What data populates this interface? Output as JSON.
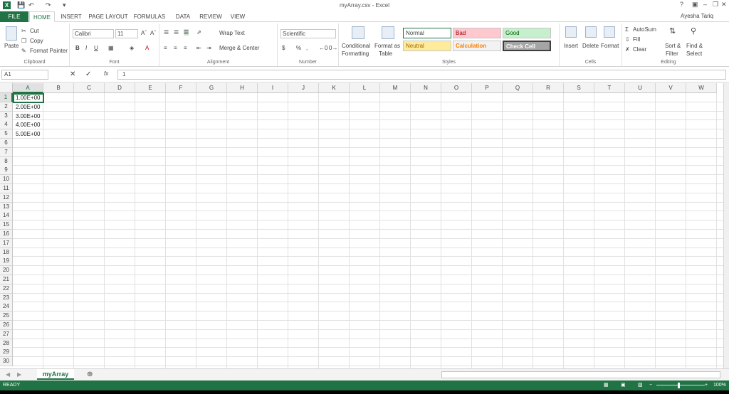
{
  "window": {
    "title": "myArray.csv - Excel",
    "help": "?",
    "user": "Ayesha Tariq"
  },
  "tabs": [
    "FILE",
    "HOME",
    "INSERT",
    "PAGE LAYOUT",
    "FORMULAS",
    "DATA",
    "REVIEW",
    "VIEW"
  ],
  "ribbon": {
    "clipboard": {
      "paste": "Paste",
      "cut": "Cut",
      "copy": "Copy",
      "format_painter": "Format Painter",
      "label": "Clipboard"
    },
    "font": {
      "name": "Calibri",
      "size": "11",
      "label": "Font",
      "bold": "B",
      "italic": "I",
      "underline": "U"
    },
    "alignment": {
      "wrap": "Wrap Text",
      "merge": "Merge & Center",
      "label": "Alignment"
    },
    "number": {
      "format": "Scientific",
      "currency": "$",
      "percent": "%",
      "comma": ",",
      "label": "Number"
    },
    "styles": {
      "conditional": "Conditional",
      "formatting": "Formatting",
      "format_as": "Format as",
      "table": "Table",
      "normal": "Normal",
      "bad": "Bad",
      "good": "Good",
      "neutral": "Neutral",
      "calculation": "Calculation",
      "check": "Check Cell",
      "label": "Styles"
    },
    "cells": {
      "insert": "Insert",
      "delete": "Delete",
      "format": "Format",
      "label": "Cells"
    },
    "editing": {
      "autosum": "AutoSum",
      "fill": "Fill",
      "clear": "Clear",
      "sort": "Sort &",
      "filter": "Filter",
      "find": "Find &",
      "select": "Select",
      "label": "Editing"
    }
  },
  "formula_bar": {
    "name_box": "A1",
    "fx": "fx",
    "value": "1"
  },
  "columns": [
    "A",
    "B",
    "C",
    "D",
    "E",
    "F",
    "G",
    "H",
    "I",
    "J",
    "K",
    "L",
    "M",
    "N",
    "O",
    "P",
    "Q",
    "R",
    "S",
    "T",
    "U",
    "V",
    "W"
  ],
  "cells": [
    "1.00E+00",
    "2.00E+00",
    "3.00E+00",
    "4.00E+00",
    "5.00E+00"
  ],
  "sheet": {
    "name": "myArray"
  },
  "status": {
    "ready": "READY",
    "zoom": "100%"
  }
}
